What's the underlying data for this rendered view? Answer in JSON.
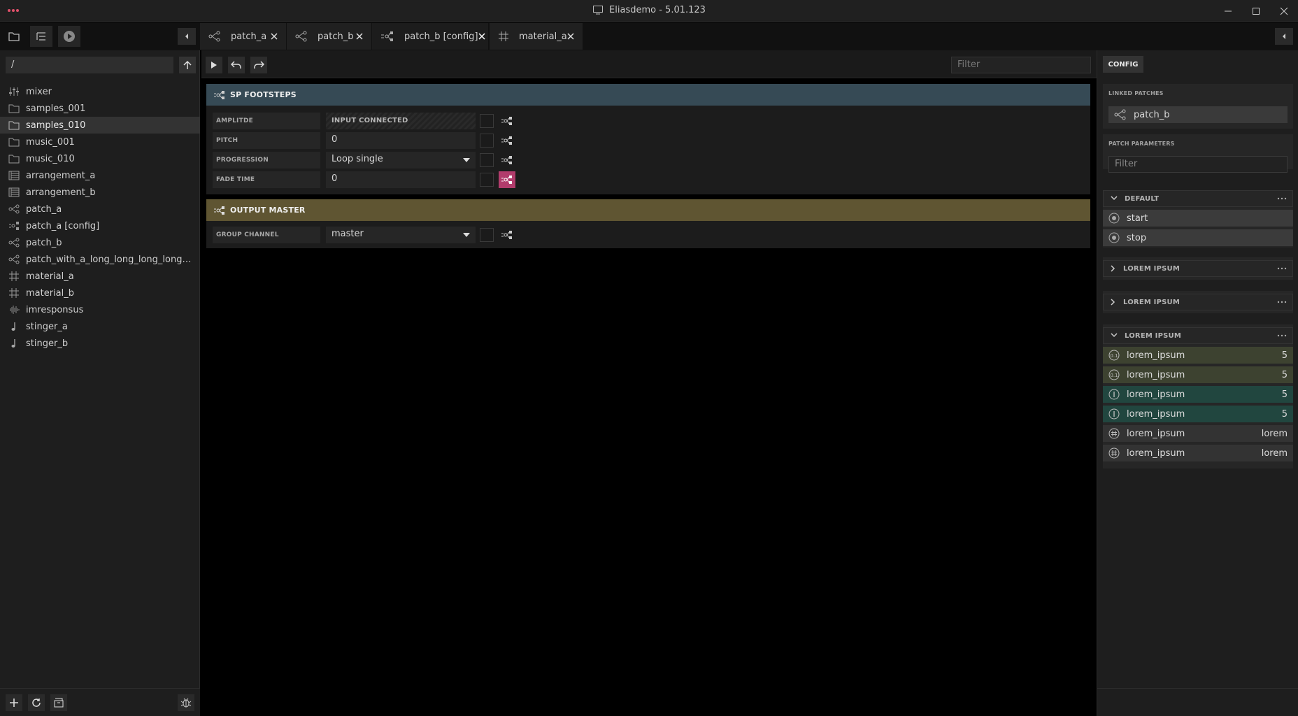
{
  "window": {
    "title": "Eliasdemo - 5.01.123"
  },
  "tabs": [
    {
      "label": "patch_a",
      "icon": "patch-icon",
      "active": false
    },
    {
      "label": "patch_b",
      "icon": "patch-icon",
      "active": false
    },
    {
      "label": "patch_b [config]",
      "icon": "patch-config-icon",
      "active": true
    },
    {
      "label": "material_a",
      "icon": "material-icon",
      "active": false
    }
  ],
  "sidebar": {
    "path": "/",
    "items": [
      {
        "label": "mixer",
        "icon": "mixer-icon"
      },
      {
        "label": "samples_001",
        "icon": "folder-icon"
      },
      {
        "label": "samples_010",
        "icon": "folder-icon",
        "selected": true
      },
      {
        "label": "music_001",
        "icon": "folder-icon"
      },
      {
        "label": "music_010",
        "icon": "folder-icon"
      },
      {
        "label": "arrangement_a",
        "icon": "arrangement-icon"
      },
      {
        "label": "arrangement_b",
        "icon": "arrangement-icon"
      },
      {
        "label": "patch_a",
        "icon": "patch-icon"
      },
      {
        "label": "patch_a [config]",
        "icon": "patch-config-icon"
      },
      {
        "label": "patch_b",
        "icon": "patch-icon"
      },
      {
        "label": "patch_with_a_long_long_long_long_long...",
        "icon": "patch-icon"
      },
      {
        "label": "material_a",
        "icon": "material-icon"
      },
      {
        "label": "material_b",
        "icon": "material-icon"
      },
      {
        "label": "imresponsus",
        "icon": "waveform-icon"
      },
      {
        "label": "stinger_a",
        "icon": "note-icon"
      },
      {
        "label": "stinger_b",
        "icon": "note-icon"
      }
    ]
  },
  "editor": {
    "filter_placeholder": "Filter",
    "groups": [
      {
        "title": "SP FOOTSTEPS",
        "color": "#364a55",
        "rows": [
          {
            "label": "AMPLITDE",
            "value": "INPUT CONNECTED",
            "kind": "connected",
            "link_active": false
          },
          {
            "label": "PITCH",
            "value": "0",
            "kind": "number",
            "link_active": false
          },
          {
            "label": "PROGRESSION",
            "value": "Loop single",
            "kind": "dropdown",
            "link_active": false
          },
          {
            "label": "FADE TIME",
            "value": "0",
            "kind": "number",
            "link_active": true
          }
        ]
      },
      {
        "title": "OUTPUT MASTER",
        "color": "#5f5532",
        "rows": [
          {
            "label": "GROUP CHANNEL",
            "value": "master",
            "kind": "dropdown",
            "link_active": false
          }
        ]
      }
    ]
  },
  "right_panel": {
    "tab": "CONFIG",
    "linked_patches_title": "LINKED PATCHES",
    "linked_patch": "patch_b",
    "patch_parameters_title": "PATCH PARAMETERS",
    "filter_placeholder": "Filter",
    "sections": [
      {
        "title": "DEFAULT",
        "expanded": true,
        "items": [
          {
            "name": "start",
            "value": "",
            "icon": "trigger-icon",
            "color": "grey"
          },
          {
            "name": "stop",
            "value": "",
            "icon": "trigger-icon",
            "color": "grey"
          }
        ]
      },
      {
        "title": "LOREM IPSUM",
        "expanded": false,
        "items": []
      },
      {
        "title": "LOREM IPSUM",
        "expanded": false,
        "items": []
      },
      {
        "title": "LOREM IPSUM",
        "expanded": true,
        "items": [
          {
            "name": "lorem_ipsum",
            "value": "5",
            "icon": "float-icon",
            "color": "olive"
          },
          {
            "name": "lorem_ipsum",
            "value": "5",
            "icon": "float-icon",
            "color": "olive"
          },
          {
            "name": "lorem_ipsum",
            "value": "5",
            "icon": "integer-icon",
            "color": "teal"
          },
          {
            "name": "lorem_ipsum",
            "value": "5",
            "icon": "integer-icon",
            "color": "teal"
          },
          {
            "name": "lorem_ipsum",
            "value": "lorem",
            "icon": "hash-icon",
            "color": "dark"
          },
          {
            "name": "lorem_ipsum",
            "value": "lorem",
            "icon": "hash-icon",
            "color": "dark"
          }
        ]
      }
    ]
  }
}
